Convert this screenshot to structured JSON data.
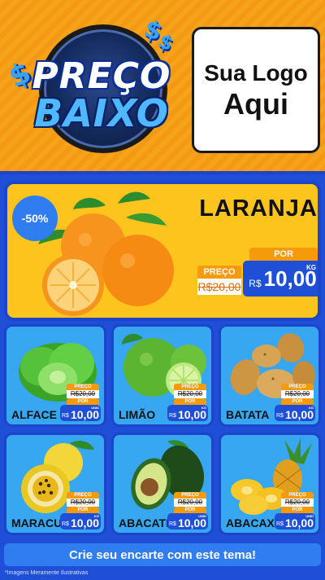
{
  "badge": {
    "line1": "PREÇO",
    "line2": "BAIXO",
    "dollar": "$"
  },
  "logo": {
    "line1": "Sua Logo",
    "line2": "Aqui"
  },
  "featured": {
    "discount": "-50%",
    "name": "LARANJA",
    "from_label": "PREÇO",
    "from_value": "R$20,00",
    "por_label": "POR",
    "currency": "R$",
    "price": "10,00",
    "unit": "KG"
  },
  "products": [
    {
      "name": "ALFACE",
      "from_label": "PREÇO",
      "from_value": "R$20,00",
      "por_label": "POR",
      "currency": "R$",
      "price": "10,00",
      "unit": "UNID"
    },
    {
      "name": "LIMÃO",
      "from_label": "PREÇO",
      "from_value": "R$20,00",
      "por_label": "POR",
      "currency": "R$",
      "price": "10,00",
      "unit": "KG"
    },
    {
      "name": "BATATA",
      "from_label": "PREÇO",
      "from_value": "R$20,00",
      "por_label": "POR",
      "currency": "R$",
      "price": "10,00",
      "unit": "KG"
    },
    {
      "name": "MARACUJÁ",
      "from_label": "PREÇO",
      "from_value": "R$20,00",
      "por_label": "POR",
      "currency": "R$",
      "price": "10,00",
      "unit": "KG"
    },
    {
      "name": "ABACATE",
      "from_label": "PREÇO",
      "from_value": "R$20,00",
      "por_label": "POR",
      "currency": "R$",
      "price": "10,00",
      "unit": "UNID"
    },
    {
      "name": "ABACAXI",
      "from_label": "PREÇO",
      "from_value": "R$20,00",
      "por_label": "POR",
      "currency": "R$",
      "price": "10,00",
      "unit": "UNID"
    }
  ],
  "cta": "Crie seu encarte com este tema!",
  "disclaimer": "*Imagens Meramente Ilustrativas",
  "colors": {
    "orange": "#f7a21b",
    "blue": "#1f4fd6",
    "yellow": "#fcc41d",
    "sky": "#36a7f0"
  }
}
